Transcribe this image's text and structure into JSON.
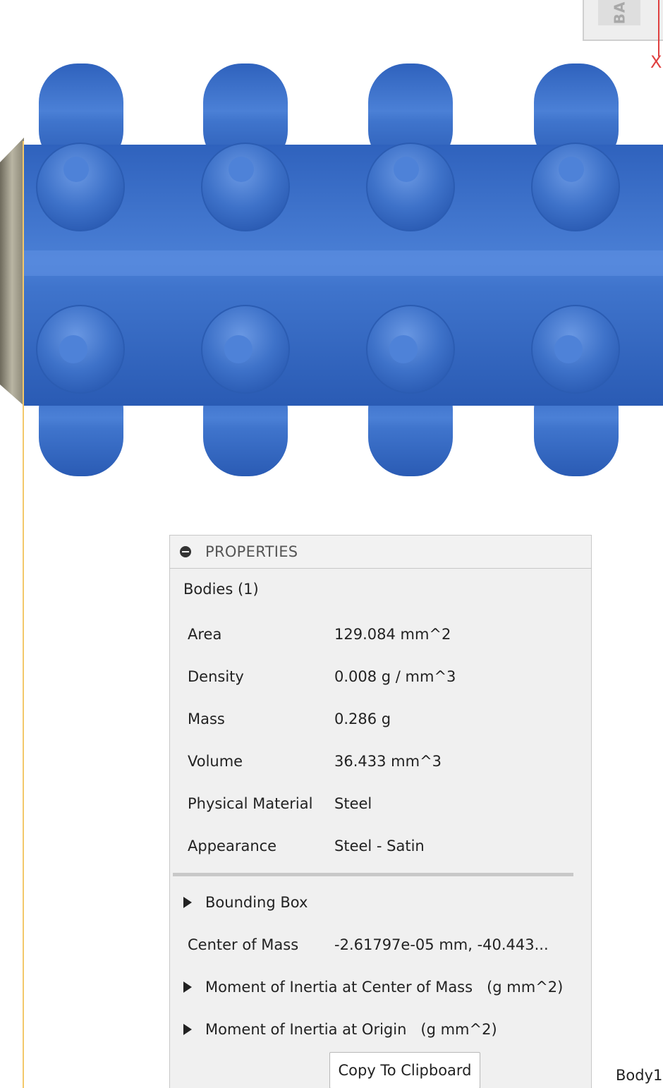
{
  "viewcube": {
    "face_label": "BA",
    "axis_label": "X"
  },
  "properties": {
    "title": "PROPERTIES",
    "bodies_label": "Bodies (1)",
    "rows": [
      {
        "label": "Area",
        "value": "129.084 mm^2"
      },
      {
        "label": "Density",
        "value": "0.008 g / mm^3"
      },
      {
        "label": "Mass",
        "value": "0.286 g"
      },
      {
        "label": "Volume",
        "value": "36.433 mm^3"
      },
      {
        "label": "Physical Material",
        "value": "Steel"
      },
      {
        "label": "Appearance",
        "value": "Steel - Satin"
      }
    ],
    "bounding_box_label": "Bounding Box",
    "center_of_mass": {
      "label": "Center of Mass",
      "value": "-2.61797e-05 mm, -40.443..."
    },
    "moment_center": {
      "label": "Moment of Inertia at Center of Mass",
      "unit": "(g mm^2)"
    },
    "moment_origin": {
      "label": "Moment of Inertia at Origin",
      "unit": "(g mm^2)"
    },
    "copy_button": "Copy To Clipboard"
  },
  "body_label": "Body1",
  "colors": {
    "model_blue": "#3b6fc7",
    "model_highlight": "#6f9be6",
    "panel_bg": "#f0f0f0",
    "axis_red": "#e04040"
  }
}
